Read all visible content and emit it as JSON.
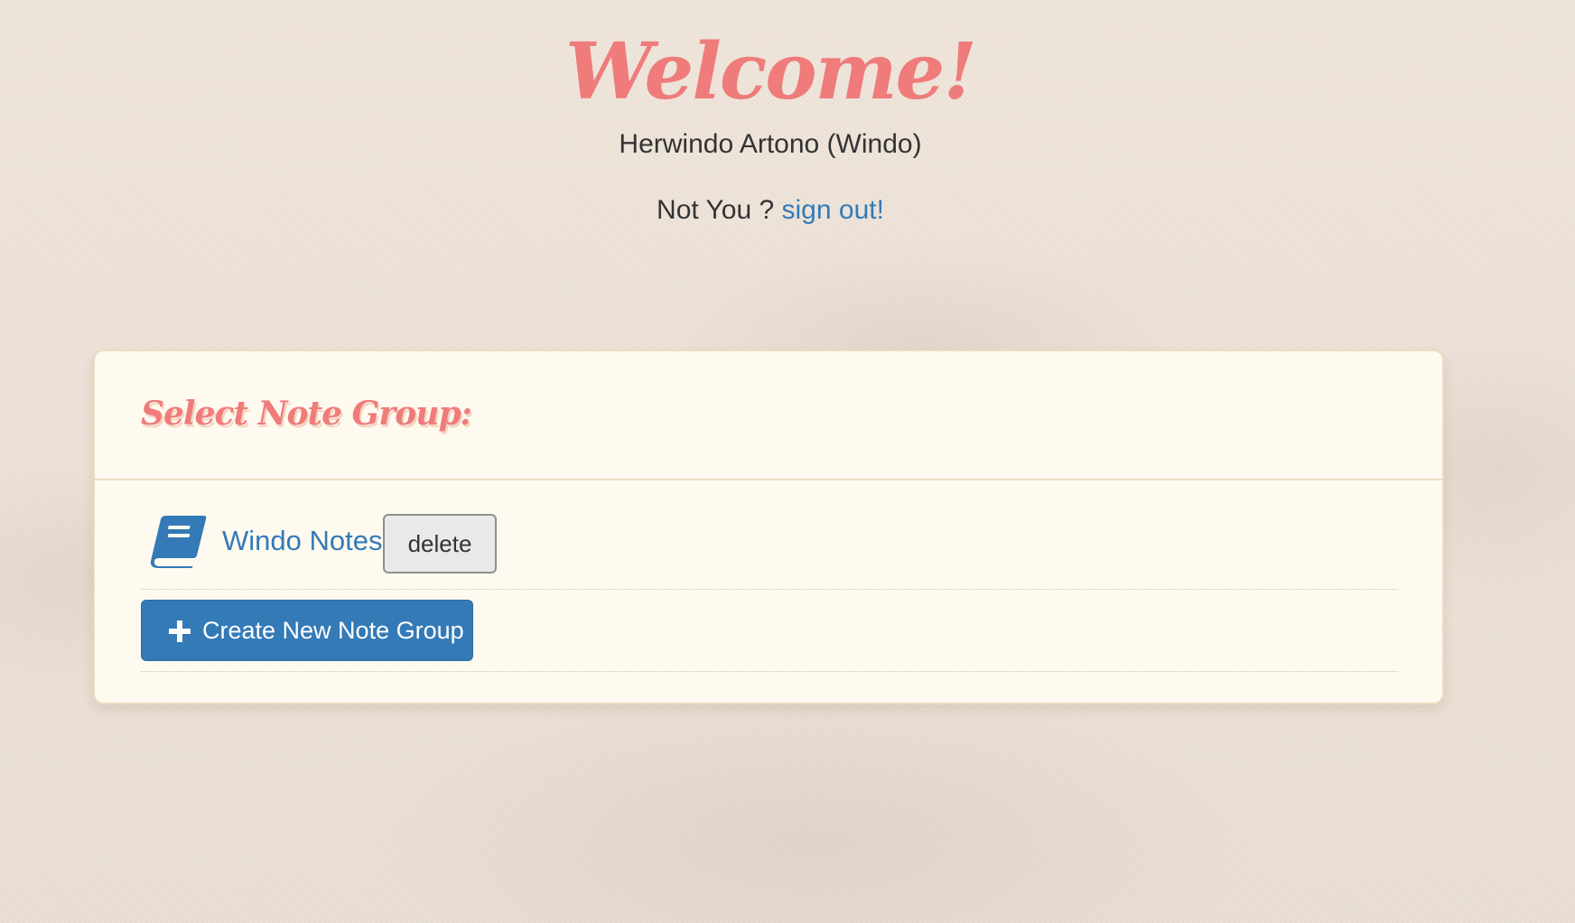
{
  "header": {
    "title": "Welcome!",
    "user_name": "Herwindo Artono (Windo)",
    "not_you_text": "Not You ?",
    "signout_label": "sign out!"
  },
  "panel": {
    "title": "Select Note Group:",
    "groups": [
      {
        "name": "Windo Notes",
        "icon": "book-icon",
        "delete_label": "delete"
      }
    ],
    "create_button": {
      "icon": "plus-icon",
      "label": "Create New Note Group"
    }
  },
  "colors": {
    "accent": "#ef7b7b",
    "link": "#337ab7",
    "primary_button": "#337ab7",
    "panel_background": "#fefaef",
    "page_background": "#ece3d8"
  }
}
